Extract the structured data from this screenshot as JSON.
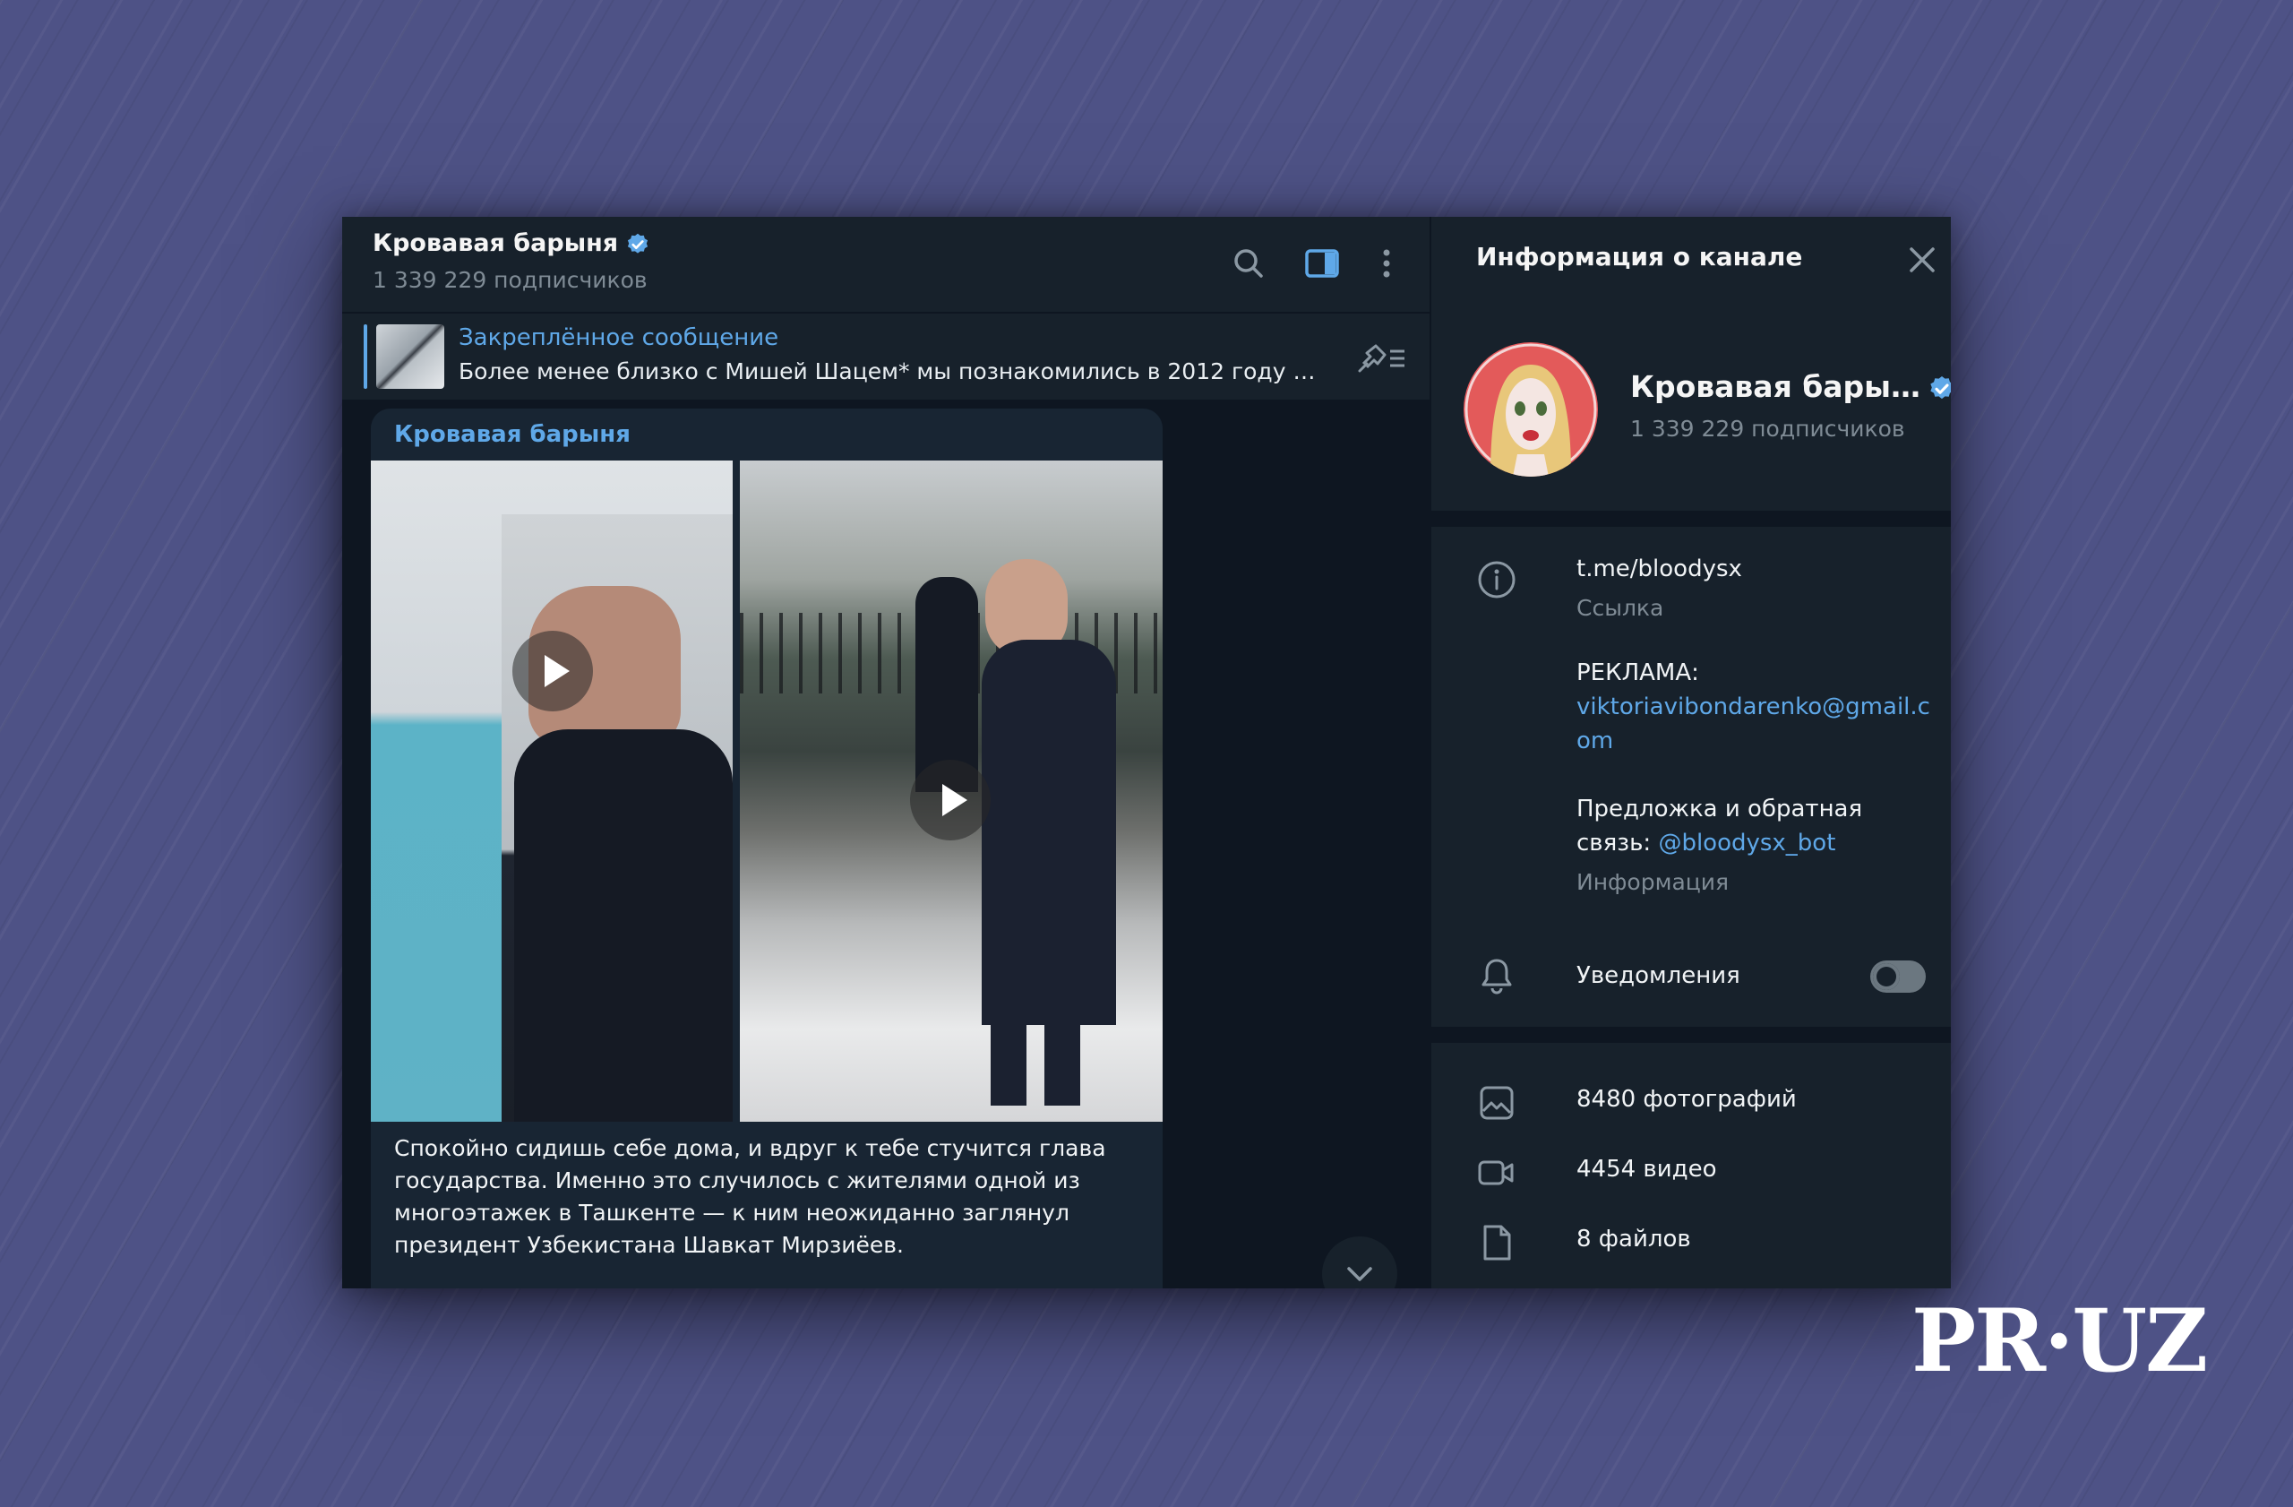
{
  "chat": {
    "title": "Кровавая барыня",
    "subscribers": "1 339 229 подписчиков"
  },
  "pinned": {
    "title": "Закреплённое сообщение",
    "text": "Более менее близко с Мишей Шацем* мы познакомились в 2012 году на …"
  },
  "message": {
    "author": "Кровавая барыня",
    "text": "Спокойно сидишь себе дома, и вдруг к тебе стучится глава государства. Именно это случилось с жителями одной из многоэтажек в Ташкенте — к ним неожиданно заглянул президент Узбекистана Шавкат Мирзиёев."
  },
  "side": {
    "title": "Информация о канале",
    "channel_name": "Кровавая бары…",
    "subscribers": "1 339 229 подписчиков",
    "link": "t.me/bloodysx",
    "link_label": "Ссылка",
    "ads_label": "РЕКЛАМА:",
    "ads_email": "viktoriavibondarenko@gmail.com",
    "feedback_text": "Предложка и обратная связь: ",
    "feedback_bot": "@bloodysx_bot",
    "info_label": "Информация",
    "notifications": "Уведомления",
    "notifications_on": false,
    "photos": "8480 фотографий",
    "videos": "4454 видео",
    "files": "8 файлов"
  },
  "colors": {
    "accent": "#5fa8e8",
    "panel": "#17212b",
    "chat_bg": "#0e1621",
    "bubble": "#182533"
  },
  "watermark": "PR·UZ"
}
